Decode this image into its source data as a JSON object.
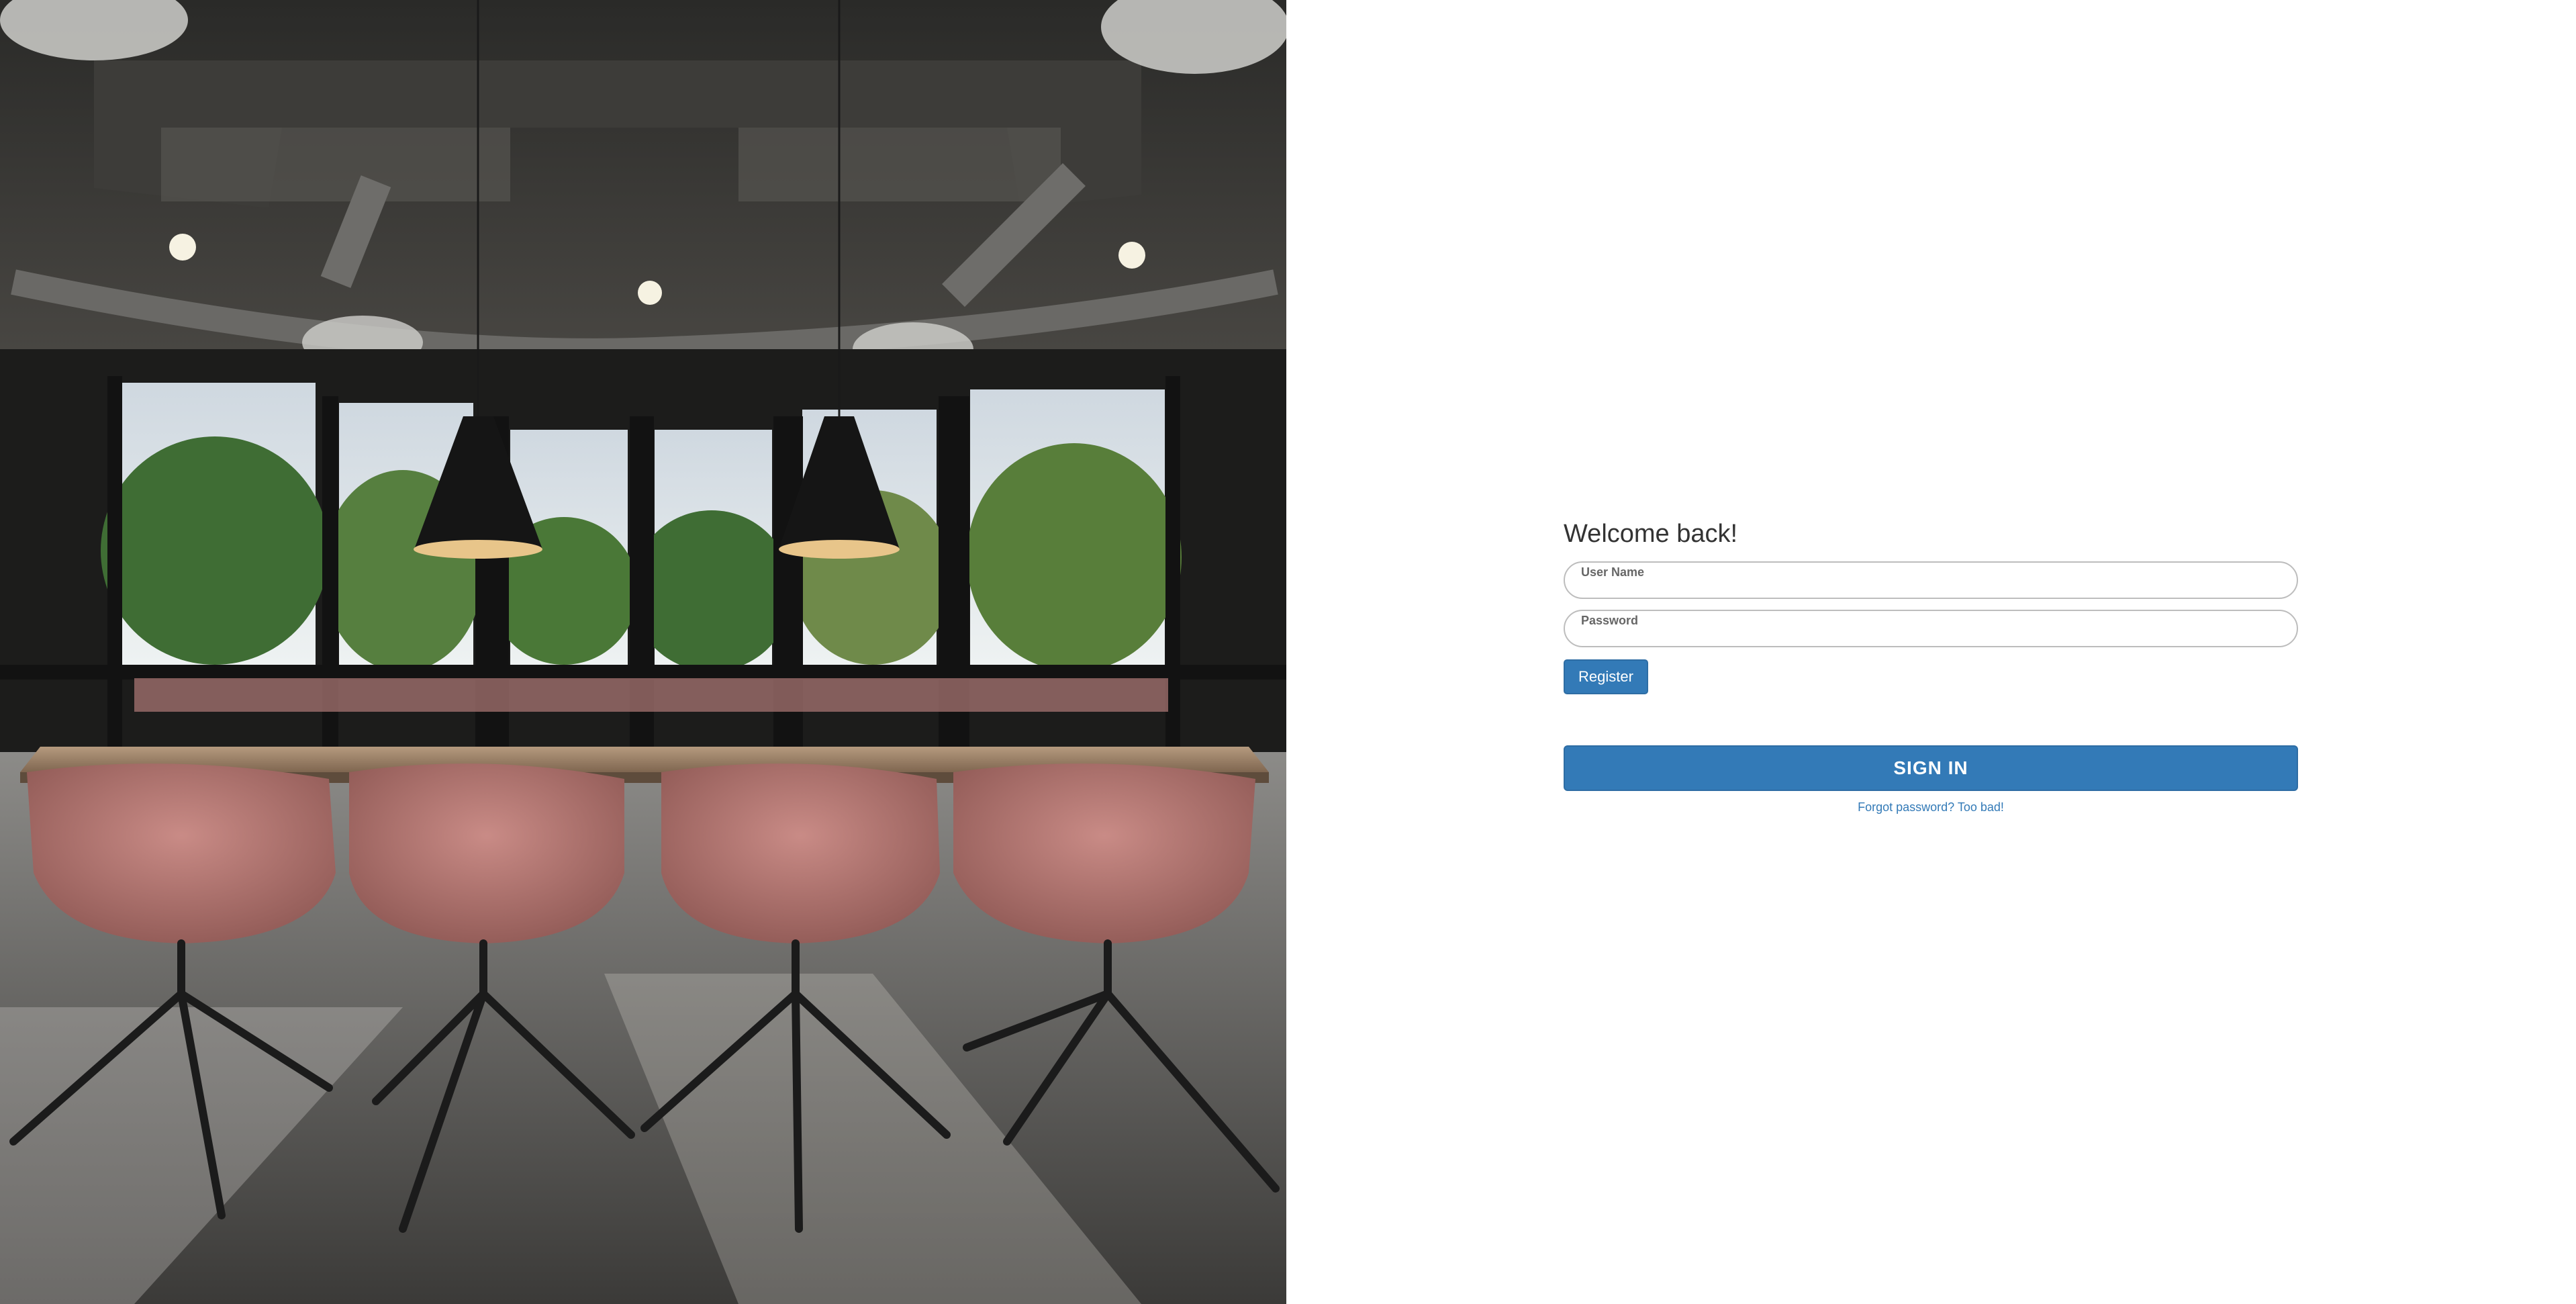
{
  "photo": {
    "subject": "conference-room-photo"
  },
  "login": {
    "welcome_title": "Welcome back!",
    "username_label": "User Name",
    "username_value": "",
    "password_label": "Password",
    "password_value": "",
    "register_label": "Register",
    "signin_label": "SIGN IN",
    "forgot_link": "Forgot password? Too bad!"
  },
  "colors": {
    "primary": "#337ab7",
    "primary_border": "#2e6da4",
    "text_dark": "#333333",
    "label_gray": "#666666",
    "field_border": "#bdbdbd"
  }
}
